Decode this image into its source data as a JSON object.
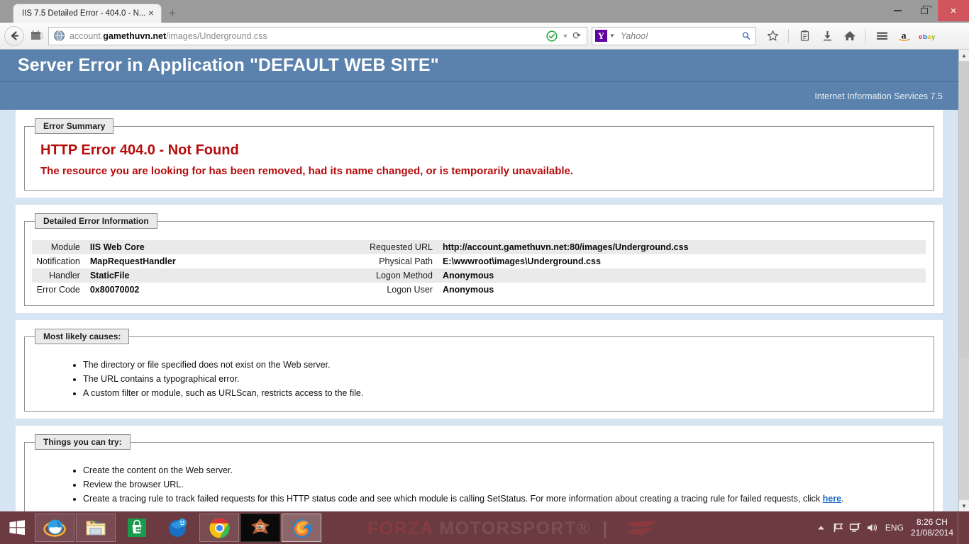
{
  "browser": {
    "tab": {
      "title": "IIS 7.5 Detailed Error - 404.0 - N...",
      "close_label": "×"
    },
    "new_tab_label": "+",
    "window_controls": {
      "minimize": "minimize-button",
      "maximize": "maximize-button",
      "close": "×"
    },
    "back_label": "←",
    "url_prefix": "account.",
    "url_domain": "gamethuvn.net",
    "url_path": "/images/Underground.css",
    "url_full": "account.gamethuvn.net/images/Underground.css",
    "reload_label": "⟳",
    "search": {
      "engine": "Yahoo!",
      "engine_badge": "Y",
      "placeholder": "Yahoo!",
      "value": "",
      "go_label": "⌕"
    },
    "toolbar_icons": [
      {
        "name": "bookmark-star-icon",
        "glyph": "☆"
      },
      {
        "name": "reading-list-icon",
        "glyph": "὜D"
      },
      {
        "name": "downloads-icon",
        "glyph": "↓"
      },
      {
        "name": "home-icon",
        "glyph": "⌂"
      },
      {
        "name": "menu-hamburger-icon",
        "glyph": "☰"
      },
      {
        "name": "amazon-icon",
        "glyph": "a"
      },
      {
        "name": "ebay-icon",
        "glyph": "ebay"
      }
    ]
  },
  "page": {
    "header_title": "Server Error in Application \"DEFAULT WEB SITE\"",
    "server_info": "Internet Information Services 7.5",
    "error_summary": {
      "legend": "Error Summary",
      "title": "HTTP Error 404.0 - Not Found",
      "description": "The resource you are looking for has been removed, had its name changed, or is temporarily unavailable."
    },
    "detailed_error": {
      "legend": "Detailed Error Information",
      "left_rows": [
        {
          "label": "Module",
          "value": "IIS Web Core"
        },
        {
          "label": "Notification",
          "value": "MapRequestHandler"
        },
        {
          "label": "Handler",
          "value": "StaticFile"
        },
        {
          "label": "Error Code",
          "value": "0x80070002"
        }
      ],
      "right_rows": [
        {
          "label": "Requested URL",
          "value": "http://account.gamethuvn.net:80/images/Underground.css"
        },
        {
          "label": "Physical Path",
          "value": "E:\\wwwroot\\images\\Underground.css"
        },
        {
          "label": "Logon Method",
          "value": "Anonymous"
        },
        {
          "label": "Logon User",
          "value": "Anonymous"
        }
      ]
    },
    "most_likely_causes": {
      "legend": "Most likely causes:",
      "items": [
        "The directory or file specified does not exist on the Web server.",
        "The URL contains a typographical error.",
        "A custom filter or module, such as URLScan, restricts access to the file."
      ]
    },
    "things_you_can_try": {
      "legend": "Things you can try:",
      "items": [
        "Create the content on the Web server.",
        "Review the browser URL."
      ],
      "last_item_prefix": "Create a tracing rule to track failed requests for this HTTP status code and see which module is calling SetStatus. For more information about creating a tracing rule for failed requests, click ",
      "last_item_link": "here",
      "last_item_suffix": "."
    },
    "scrollbar": {
      "up": "▲",
      "down": "▼"
    }
  },
  "taskbar": {
    "watermark_red": "FORZA",
    "watermark_white": "MOTORSPORT®",
    "watermark_divider": "|",
    "start_label": "start-button",
    "items": [
      {
        "name": "taskbar-internet-explorer",
        "label": "Internet Explorer"
      },
      {
        "name": "taskbar-file-explorer",
        "label": "File Explorer"
      },
      {
        "name": "taskbar-store",
        "label": "Store"
      },
      {
        "name": "taskbar-maxthon",
        "label": "Maxthon"
      },
      {
        "name": "taskbar-google-chrome",
        "label": "Google Chrome"
      },
      {
        "name": "taskbar-game",
        "label": "Game"
      },
      {
        "name": "taskbar-firefox",
        "label": "Mozilla Firefox"
      }
    ],
    "tray": {
      "show_hidden": "▲",
      "language": "ENG",
      "time": "8:26 CH",
      "date": "21/08/2014"
    }
  },
  "colors": {
    "header_blue": "#5a82ad",
    "page_bg": "#d7e5f2",
    "error_red": "#b50b0b",
    "link_blue": "#1569c7",
    "taskbar": "#6b3b41"
  }
}
